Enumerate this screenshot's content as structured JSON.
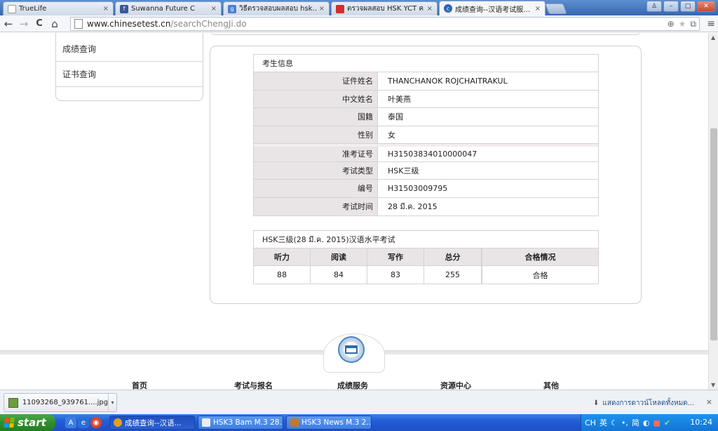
{
  "tabs": [
    {
      "title": "TrueLife",
      "close": "×"
    },
    {
      "title": "Suwanna Future C",
      "close": "×"
    },
    {
      "title": "วิธีตรวจสอบผลสอบ hsk…",
      "close": "×"
    },
    {
      "title": "ตรวจผลสอบ HSK YCT ค…",
      "close": "×"
    },
    {
      "title": "成绩查询--汉语考试服…",
      "close": "×"
    }
  ],
  "window_buttons": {
    "user": "♙",
    "minimize": "–",
    "maximize": "□",
    "close": "✕"
  },
  "toolbar": {
    "back": "←",
    "forward": "→",
    "reload": "C",
    "home": "⌂",
    "url_host": "www.chinesetest.cn",
    "url_path": "/searchChengJi.do",
    "zoom_icon": "⊕",
    "star_icon": "★",
    "ext_icon": "⧉",
    "menu_icon": "≡"
  },
  "sidebar": {
    "items": [
      {
        "label": "成绩查询"
      },
      {
        "label": "证书查询"
      }
    ]
  },
  "candidate": {
    "heading": "考生信息",
    "rows": [
      {
        "label": "证件姓名",
        "value": "THANCHANOK ROJCHAITRAKUL"
      },
      {
        "label": "中文姓名",
        "value": "叶美燕"
      },
      {
        "label": "国籍",
        "value": "泰国"
      },
      {
        "label": "性别",
        "value": "女"
      },
      {
        "label": "准考证号",
        "value": "H31503834010000047"
      },
      {
        "label": "考试类型",
        "value": "HSK三级"
      },
      {
        "label": "编号",
        "value": "H31503009795"
      },
      {
        "label": "考试时间",
        "value": "28 มี.ค. 2015"
      }
    ]
  },
  "score": {
    "heading": "HSK三级(28 มี.ค. 2015)汉语水平考试",
    "columns": [
      "听力",
      "阅读",
      "写作",
      "总分",
      "合格情况"
    ],
    "values": [
      "88",
      "84",
      "83",
      "255",
      "合格"
    ]
  },
  "footer": {
    "nav": [
      "首页",
      "考试与报名",
      "成绩服务",
      "资源中心",
      "其他"
    ]
  },
  "downloads": {
    "file": "11093268_939761....jpg",
    "caret": "▾",
    "show_all": "แสดงการดาวน์โหลดทั้งหมด...",
    "close": "×"
  },
  "taskbar": {
    "start": "start",
    "buttons": [
      {
        "label": "成绩查询--汉语..."
      },
      {
        "label": "HSK3 Bam M.3 28..."
      },
      {
        "label": "HSK3 News M.3 2..."
      }
    ],
    "tray_lang": "CH",
    "tray_ime": "英",
    "tray_ime2": "简",
    "clock": "10:24"
  },
  "colors": {
    "panel_border": "#cfcfcf",
    "label_bg": "#e9e5e6",
    "taskbar_blue": "#245dd7",
    "start_green": "#2f8f2d"
  }
}
